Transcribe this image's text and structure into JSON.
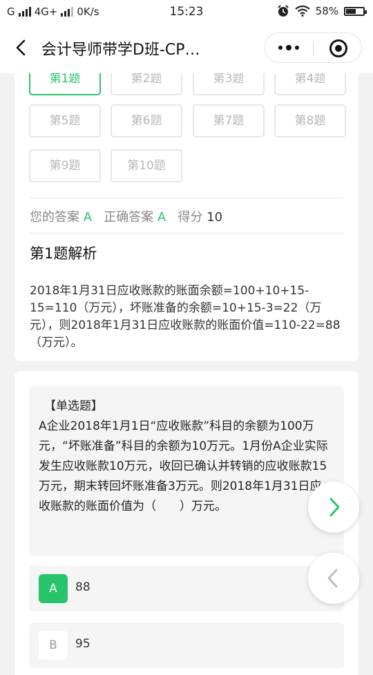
{
  "status_bar": {
    "carrier": "G",
    "network": "4G+",
    "speed": "0K/s",
    "time": "15:23",
    "battery": "58%",
    "battery_level": 0.58,
    "icons": [
      "signal-bars-icon",
      "alarm-icon",
      "wifi-icon",
      "battery-icon"
    ]
  },
  "nav": {
    "title": "会计导师带学D班-CP…",
    "back_icon": "chevron-left-icon",
    "more_icon": "more-dots-icon",
    "close_icon": "target-circle-icon"
  },
  "question_grid": {
    "items": [
      "第1题",
      "第2题",
      "第3题",
      "第4题",
      "第5题",
      "第6题",
      "第7题",
      "第8题",
      "第9题",
      "第10题"
    ],
    "active_index": 0
  },
  "result": {
    "your_answer_label": "您的答案",
    "your_answer": "A",
    "correct_answer_label": "正确答案",
    "correct_answer": "A",
    "score_label": "得分",
    "score": "10"
  },
  "analysis": {
    "title": "第1题解析",
    "text": "2018年1月31日应收账款的账面余额=100+10+15-15=110（万元），坏账准备的余额=10+15-3=22（万元），则2018年1月31日应收账款的账面价值=110-22=88（万元）。"
  },
  "question": {
    "type_label": "【单选题】",
    "text": "A企业2018年1月1日“应收账款”科目的余额为100万元，“坏账准备”科目的余额为10万元。1月份A企业实际发生应收账款10万元，收回已确认并转销的应收账款15万元，期末转回坏账准备3万元。则2018年1月31日应收账款的账面价值为（　　）万元。",
    "options": [
      {
        "letter": "A",
        "text": "88",
        "selected": true
      },
      {
        "letter": "B",
        "text": "95",
        "selected": false
      }
    ]
  },
  "floating": {
    "next_icon": "chevron-right-icon",
    "prev_icon": "chevron-left-icon",
    "accent": "#27c46b"
  }
}
